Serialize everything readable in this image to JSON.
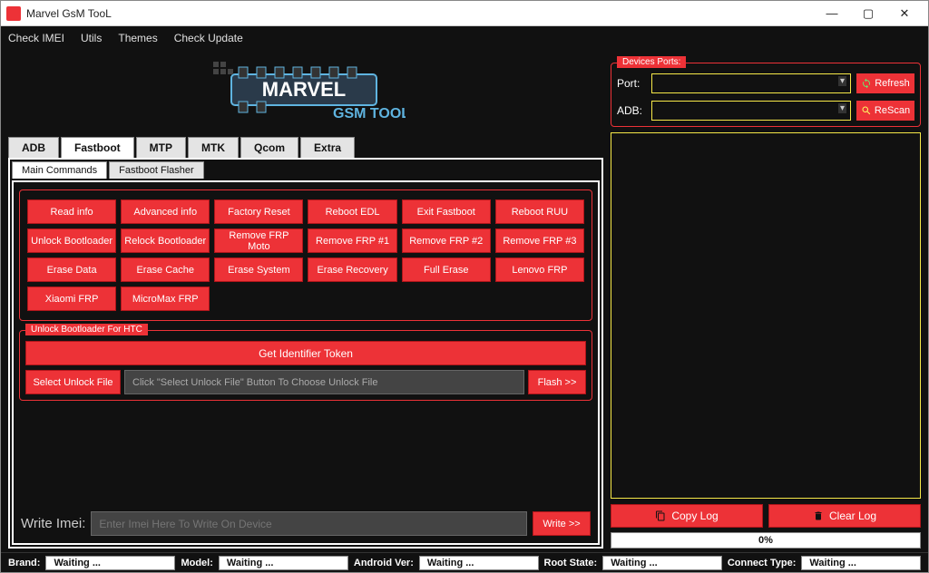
{
  "window": {
    "title": "Marvel GsM TooL"
  },
  "menu": [
    "Check IMEI",
    "Utils",
    "Themes",
    "Check Update"
  ],
  "logo": {
    "line1": "MARVEL",
    "line2": "GSM TOOL"
  },
  "mainTabs": [
    "ADB",
    "Fastboot",
    "MTP",
    "MTK",
    "Qcom",
    "Extra"
  ],
  "mainTabActive": 1,
  "subTabs": [
    "Main Commands",
    "Fastboot Flasher"
  ],
  "subTabActive": 0,
  "commands": [
    "Read info",
    "Advanced info",
    "Factory Reset",
    "Reboot EDL",
    "Exit Fastboot",
    "Reboot RUU",
    "Unlock Bootloader",
    "Relock Bootloader",
    "Remove FRP Moto",
    "Remove FRP #1",
    "Remove FRP #2",
    "Remove FRP #3",
    "Erase Data",
    "Erase Cache",
    "Erase System",
    "Erase Recovery",
    "Full Erase",
    "Lenovo FRP",
    "Xiaomi FRP",
    "MicroMax FRP"
  ],
  "htc": {
    "legend": "Unlock Bootloader For HTC",
    "getToken": "Get Identifier Token",
    "selectFile": "Select Unlock File",
    "pathPlaceholder": "Click \"Select Unlock File\" Button To Choose Unlock File",
    "flash": "Flash >>"
  },
  "imei": {
    "label": "Write Imei:",
    "placeholder": "Enter Imei Here To Write On Device",
    "write": "Write >>"
  },
  "devices": {
    "legend": "Devices Ports:",
    "portLabel": "Port:",
    "adbLabel": "ADB:",
    "refresh": "Refresh",
    "rescan": "ReScan"
  },
  "log": {
    "copy": "Copy Log",
    "clear": "Clear Log",
    "progress": "0%"
  },
  "status": {
    "brandLabel": "Brand:",
    "brand": "Waiting ...",
    "modelLabel": "Model:",
    "model": "Waiting ...",
    "androidLabel": "Android Ver:",
    "android": "Waiting ...",
    "rootLabel": "Root State:",
    "root": "Waiting ...",
    "connectLabel": "Connect Type:",
    "connect": "Waiting ..."
  }
}
